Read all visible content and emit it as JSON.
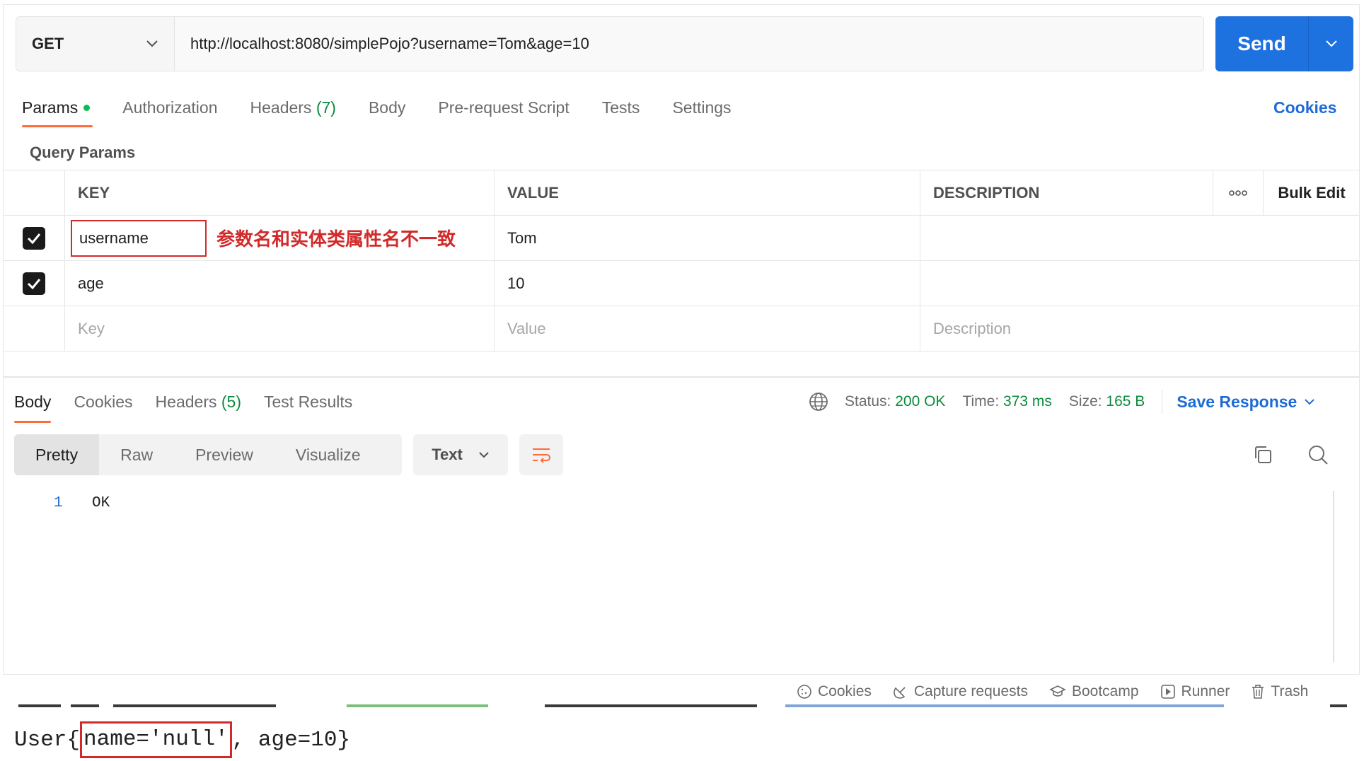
{
  "request": {
    "method": "GET",
    "url": "http://localhost:8080/simplePojo?username=Tom&age=10",
    "send_label": "Send"
  },
  "request_tabs": [
    {
      "label": "Params",
      "active": true
    },
    {
      "label": "Authorization"
    },
    {
      "label": "Headers",
      "count": "(7)"
    },
    {
      "label": "Body"
    },
    {
      "label": "Pre-request Script"
    },
    {
      "label": "Tests"
    },
    {
      "label": "Settings"
    }
  ],
  "cookies_link": "Cookies",
  "query_params": {
    "title": "Query Params",
    "headers": {
      "key": "KEY",
      "value": "VALUE",
      "description": "DESCRIPTION",
      "bulk_edit": "Bulk Edit"
    },
    "rows": [
      {
        "checked": true,
        "key": "username",
        "value": "Tom",
        "annotation": "参数名和实体类属性名不一致"
      },
      {
        "checked": true,
        "key": "age",
        "value": "10"
      }
    ],
    "placeholders": {
      "key": "Key",
      "value": "Value",
      "description": "Description"
    }
  },
  "response": {
    "tabs": [
      {
        "label": "Body",
        "active": true
      },
      {
        "label": "Cookies"
      },
      {
        "label": "Headers",
        "count": "(5)"
      },
      {
        "label": "Test Results"
      }
    ],
    "status_label": "Status:",
    "status_value": "200 OK",
    "time_label": "Time:",
    "time_value": "373 ms",
    "size_label": "Size:",
    "size_value": "165 B",
    "save_response": "Save Response",
    "views": [
      "Pretty",
      "Raw",
      "Preview",
      "Visualize"
    ],
    "format": "Text",
    "body_lines": [
      {
        "no": "1",
        "text": "OK"
      }
    ]
  },
  "footer": [
    {
      "label": "Cookies",
      "icon": "cookie-icon"
    },
    {
      "label": "Capture requests",
      "icon": "satellite-icon"
    },
    {
      "label": "Bootcamp",
      "icon": "graduation-cap-icon"
    },
    {
      "label": "Runner",
      "icon": "play-icon"
    },
    {
      "label": "Trash",
      "icon": "trash-icon"
    }
  ],
  "console": {
    "prefix": "User{",
    "highlight": "name='null'",
    "suffix": ", age=10}"
  },
  "colors": {
    "accent": "#ff6c37",
    "send": "#1e72e0",
    "link": "#1e6bd6",
    "annotation": "#d22a2a",
    "status_green": "#0a8b3c"
  }
}
